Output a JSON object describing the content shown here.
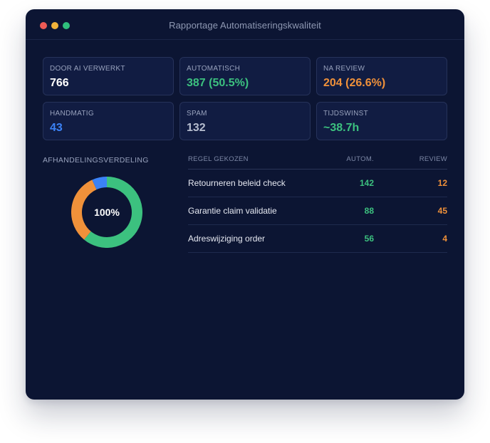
{
  "window": {
    "title": "Rapportage Automatiseringskwaliteit",
    "controls": [
      {
        "name": "close",
        "color": "#ed5a55"
      },
      {
        "name": "minimize",
        "color": "#f1b23a"
      },
      {
        "name": "maximize",
        "color": "#2fbf7c"
      }
    ]
  },
  "stats": [
    {
      "label": "DOOR AI VERWERKT",
      "value": "766",
      "color": "#ffffff"
    },
    {
      "label": "AUTOMATISCH",
      "value": "387 (50.5%)",
      "color": "#3cc17f"
    },
    {
      "label": "NA REVIEW",
      "value": "204 (26.6%)",
      "color": "#f0913a"
    },
    {
      "label": "HANDMATIG",
      "value": "43",
      "color": "#3b82f6"
    },
    {
      "label": "SPAM",
      "value": "132",
      "color": "#b6bdcf"
    },
    {
      "label": "TIJDSWINST",
      "value": "~38.7h",
      "color": "#3cc17f"
    }
  ],
  "distribution": {
    "title": "AFHANDELINGSVERDELING",
    "center_label": "100%",
    "segments": [
      {
        "name": "automatisch",
        "value": 387,
        "color": "#3cc17f"
      },
      {
        "name": "review",
        "value": 204,
        "color": "#f0913a"
      },
      {
        "name": "handmatig",
        "value": 43,
        "color": "#3b82f6"
      }
    ]
  },
  "rules_table": {
    "headers": {
      "name": "REGEL GEKOZEN",
      "auto": "AUTOM.",
      "review": "REVIEW"
    },
    "auto_color": "#3cc17f",
    "review_color": "#f0913a",
    "rows": [
      {
        "name": "Retourneren beleid check",
        "auto": "142",
        "review": "12"
      },
      {
        "name": "Garantie claim validatie",
        "auto": "88",
        "review": "45"
      },
      {
        "name": "Adreswijziging order",
        "auto": "56",
        "review": "4"
      }
    ]
  }
}
